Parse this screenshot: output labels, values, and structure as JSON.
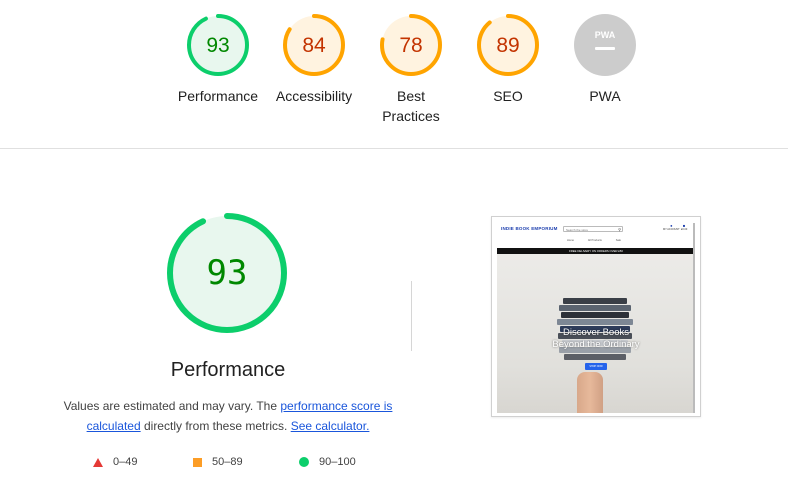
{
  "gauges": [
    {
      "label": "Performance",
      "score": "93",
      "value": 93,
      "color": "#0cce6b",
      "text_color": "#008800",
      "bg": "#e8f7ee"
    },
    {
      "label": "Accessibility",
      "score": "84",
      "value": 84,
      "color": "#ffa400",
      "text_color": "#c33300",
      "bg": "#fff3e0"
    },
    {
      "label": "Best Practices",
      "score": "78",
      "value": 78,
      "color": "#ffa400",
      "text_color": "#c33300",
      "bg": "#fff3e0"
    },
    {
      "label": "SEO",
      "score": "89",
      "value": 89,
      "color": "#ffa400",
      "text_color": "#c33300",
      "bg": "#fff3e0"
    },
    {
      "label": "PWA",
      "score": "PWA",
      "value": 0,
      "color": "#cccccc",
      "text_color": "#ffffff",
      "bg": "#cccccc"
    }
  ],
  "performance": {
    "score": "93",
    "value": 93,
    "title": "Performance",
    "desc_text_1": "Values are estimated and may vary. The ",
    "desc_link_1": "performance score is calculated",
    "desc_text_2": " directly from these metrics. ",
    "desc_link_2": "See calculator."
  },
  "legend": [
    {
      "range": "0–49",
      "shape": "triangle",
      "color": "#e53935"
    },
    {
      "range": "50–89",
      "shape": "square",
      "color": "#fb8c00"
    },
    {
      "range": "90–100",
      "shape": "circle",
      "color": "#0cce6b"
    }
  ],
  "screenshot": {
    "logo": "INDIE BOOK EMPORIUM",
    "search_placeholder": "Search the store",
    "nav": [
      "Home",
      "All Products",
      "Sale"
    ],
    "announcement": "FREE DELIVERY ON ORDERS OVER £50",
    "hero_line1": "Discover Books",
    "hero_line2": "Beyond the Ordinary",
    "hero_button": "SHOP NOW",
    "account_label": "MY ACCOUNT",
    "bag_label": "£0.00"
  }
}
